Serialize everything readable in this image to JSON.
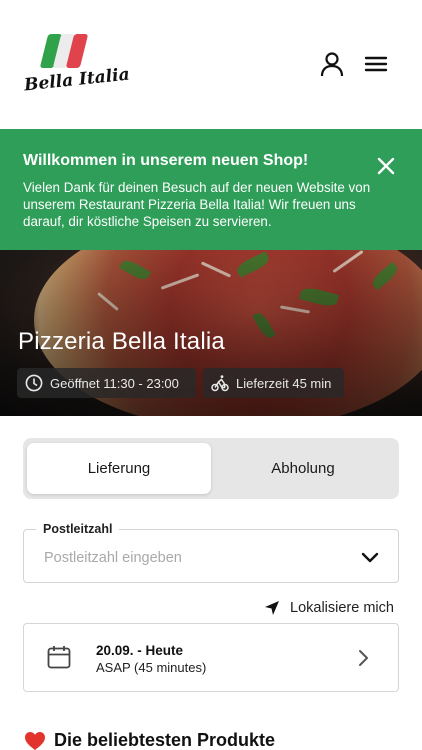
{
  "header": {
    "logo_text": "Bella Italia",
    "user_icon": "user-icon",
    "menu_icon": "hamburger-menu-icon"
  },
  "banner": {
    "title": "Willkommen in unserem neuen Shop!",
    "text": "Vielen Dank für deinen Besuch auf der neuen Website von unserem Restaurant Pizzeria Bella Italia! Wir freuen uns darauf, dir köstliche Speisen zu servieren.",
    "close_icon": "close-icon",
    "color": "#2e9e58"
  },
  "hero": {
    "title": "Pizzeria Bella Italia",
    "hours": "Geöffnet 11:30 - 23:00",
    "delivery_time": "Lieferzeit 45 min",
    "hours_icon": "clock-icon",
    "delivery_icon": "bike-icon"
  },
  "tabs": [
    {
      "label": "Lieferung",
      "active": true
    },
    {
      "label": "Abholung",
      "active": false
    }
  ],
  "postal": {
    "label": "Postleitzahl",
    "placeholder": "Postleitzahl eingeben",
    "value": ""
  },
  "locate": {
    "label": "Lokalisiere mich",
    "icon": "location-arrow-icon"
  },
  "date": {
    "date_label": "20.09. - Heute",
    "time_label": "ASAP (45 minutes)",
    "icon": "calendar-icon"
  },
  "popular": {
    "title": "Die beliebtesten Produkte",
    "icon": "heart-icon"
  }
}
